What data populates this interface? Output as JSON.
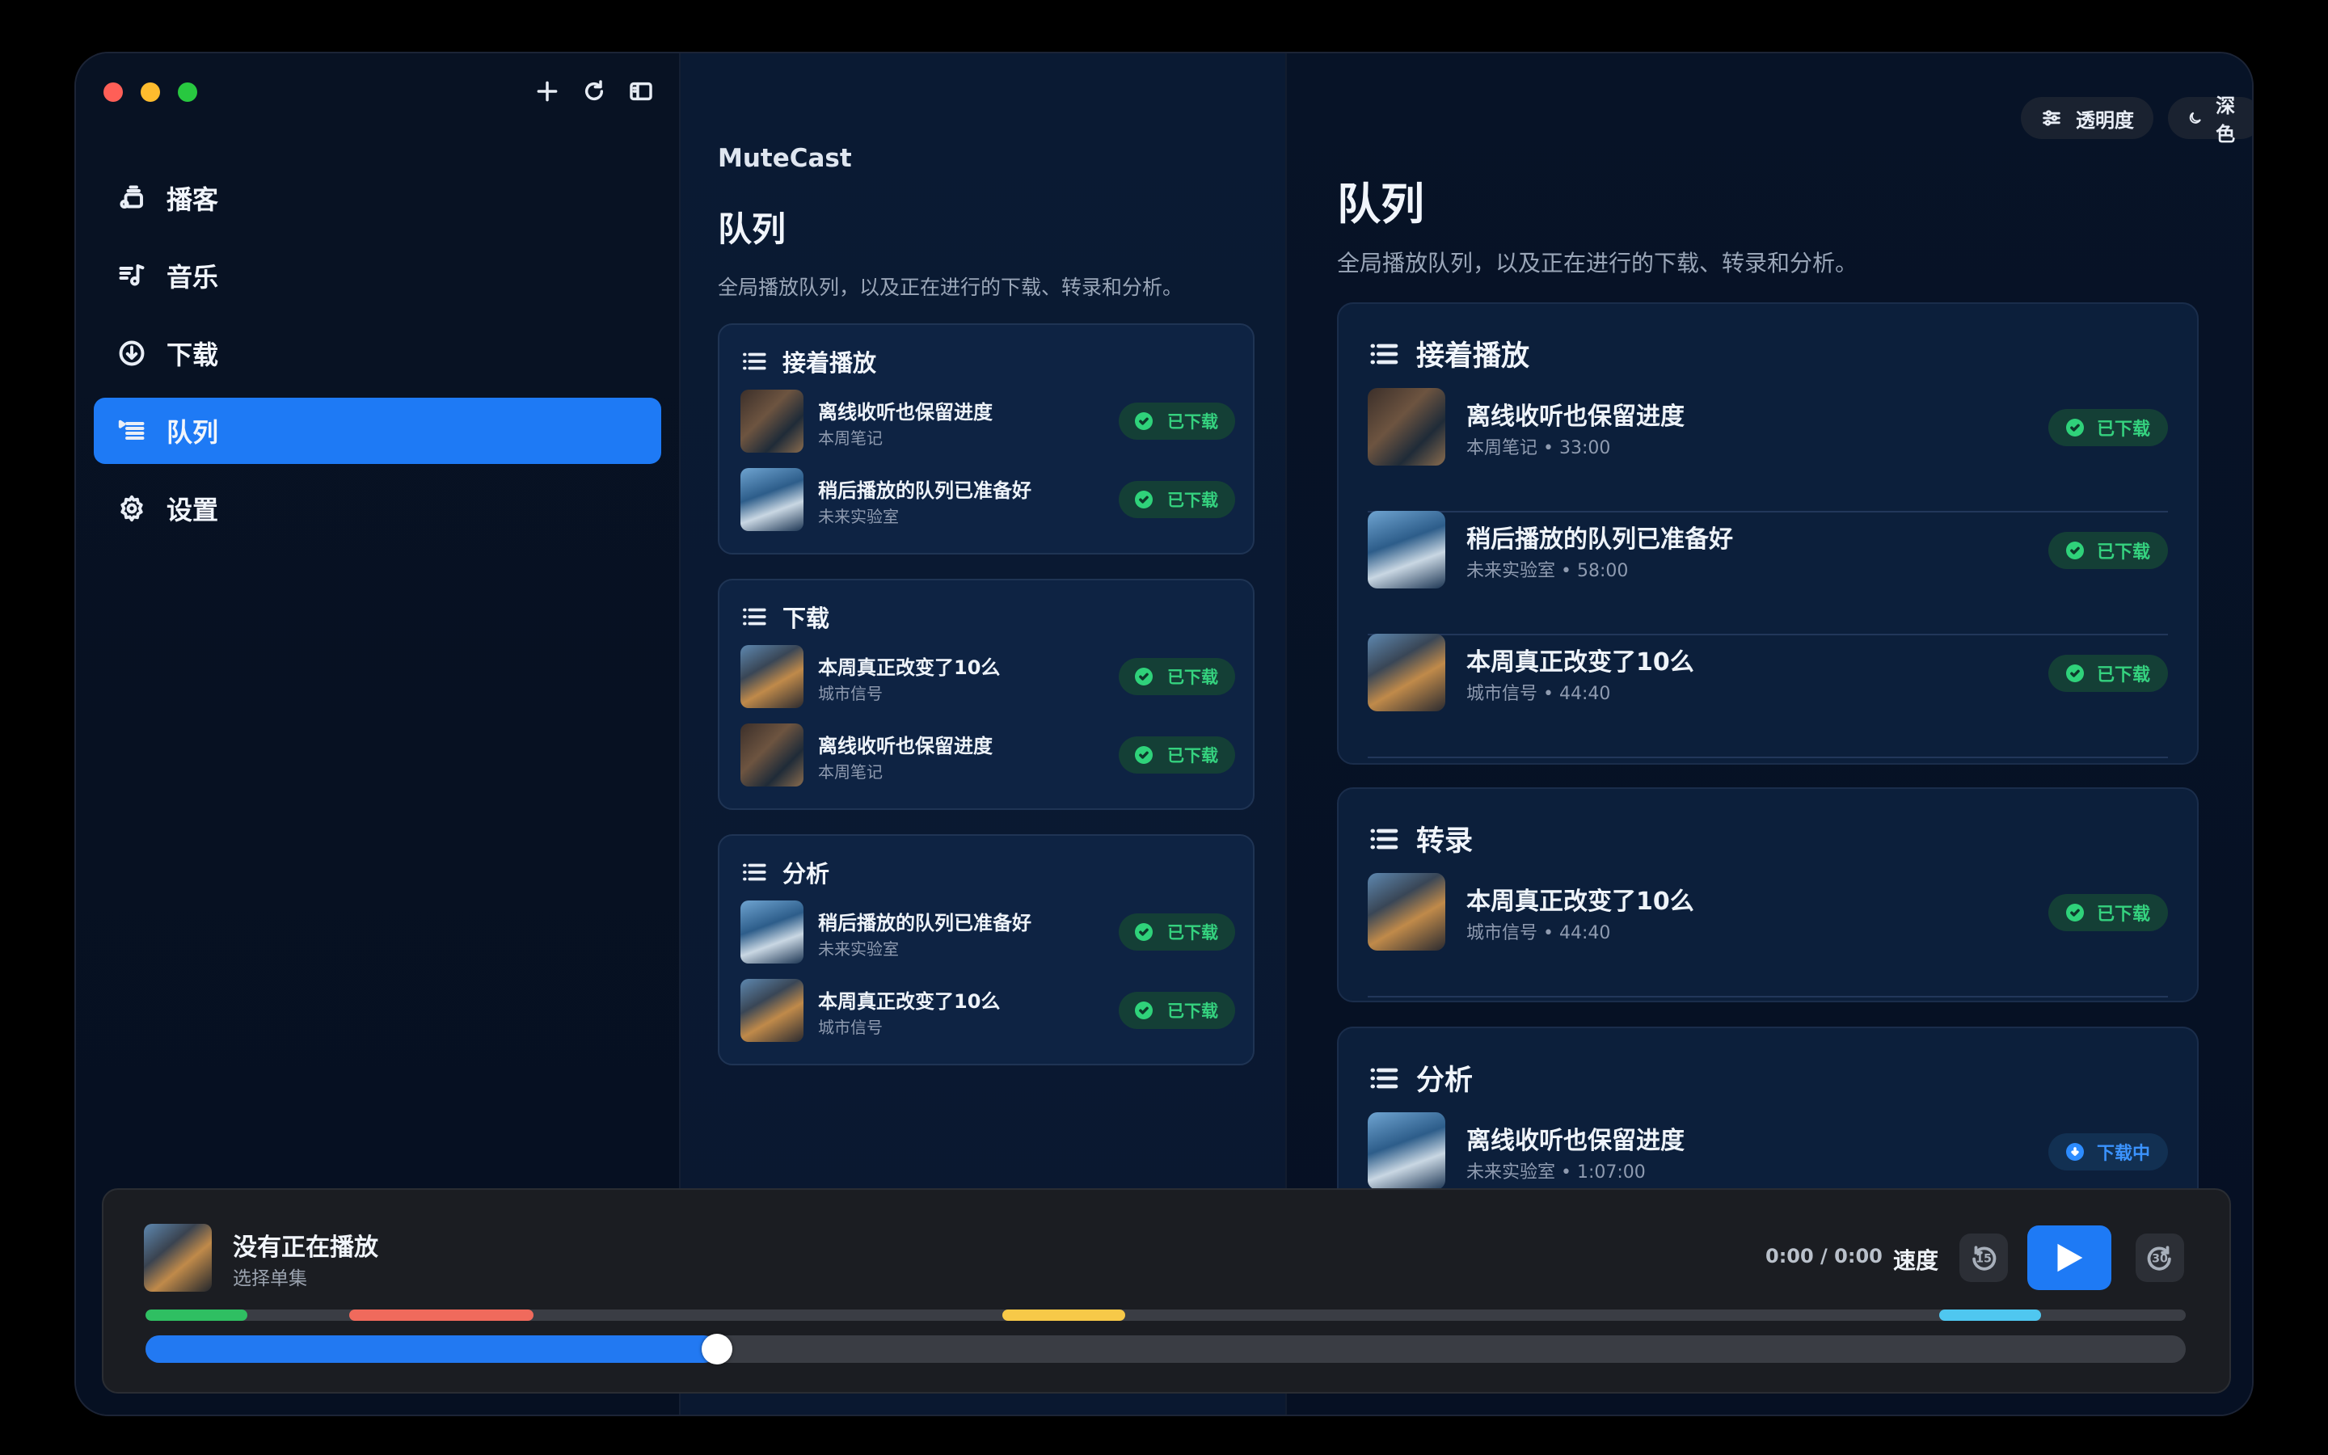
{
  "sidebar": {
    "items": [
      {
        "label": "播客",
        "icon": "podcast-icon"
      },
      {
        "label": "音乐",
        "icon": "music-icon"
      },
      {
        "label": "下载",
        "icon": "download-icon"
      },
      {
        "label": "队列",
        "icon": "queue-icon",
        "active": true
      },
      {
        "label": "设置",
        "icon": "gear-icon"
      }
    ]
  },
  "middle": {
    "app_name": "MuteCast",
    "title": "队列",
    "subtitle": "全局播放队列，以及正在进行的下载、转录和分析。",
    "sections": [
      {
        "title": "接着播放",
        "rows": [
          {
            "title": "离线收听也保留进度",
            "show": "本周笔记",
            "status": "已下载"
          },
          {
            "title": "稍后播放的队列已准备好",
            "show": "未来实验室",
            "status": "已下载"
          }
        ]
      },
      {
        "title": "下载",
        "rows": [
          {
            "title": "本周真正改变了10么",
            "show": "城市信号",
            "status": "已下载"
          },
          {
            "title": "离线收听也保留进度",
            "show": "本周笔记",
            "status": "已下载"
          }
        ]
      },
      {
        "title": "分析",
        "rows": [
          {
            "title": "稍后播放的队列已准备好",
            "show": "未来实验室",
            "status": "已下载"
          },
          {
            "title": "本周真正改变了10么",
            "show": "城市信号",
            "status": "已下载"
          }
        ]
      }
    ]
  },
  "right": {
    "opacity_label": "透明度",
    "theme_label": "深色",
    "title": "队列",
    "subtitle": "全局播放队列，以及正在进行的下载、转录和分析。",
    "sections": [
      {
        "title": "接着播放",
        "rows": [
          {
            "title": "离线收听也保留进度",
            "meta": "本周笔记 • 33:00",
            "status": "已下载"
          },
          {
            "title": "稍后播放的队列已准备好",
            "meta": "未来实验室 • 58:00",
            "status": "已下载"
          },
          {
            "title": "本周真正改变了10么",
            "meta": "城市信号 • 44:40",
            "status": "已下载"
          }
        ]
      },
      {
        "title": "转录",
        "rows": [
          {
            "title": "本周真正改变了10么",
            "meta": "城市信号 • 44:40",
            "status": "已下载"
          }
        ]
      },
      {
        "title": "分析",
        "rows": [
          {
            "title": "离线收听也保留进度",
            "meta": "未来实验室 • 1:07:00",
            "status": "下载中"
          }
        ]
      }
    ]
  },
  "player": {
    "title": "没有正在播放",
    "subtitle": "选择单集",
    "time": "0:00 / 0:00",
    "speed_label": "速度",
    "rewind_seconds": "15",
    "forward_seconds": "30",
    "progress_fraction": 0.28,
    "segments": [
      {
        "start": 0.0,
        "end": 0.05,
        "color": "#2fbf62"
      },
      {
        "start": 0.1,
        "end": 0.19,
        "color": "#f06a5c"
      },
      {
        "start": 0.42,
        "end": 0.48,
        "color": "#f7c948"
      },
      {
        "start": 0.879,
        "end": 0.929,
        "color": "#4fc7f0"
      }
    ]
  },
  "colors": {
    "accent": "#1e7af5",
    "success": "#35d27f",
    "progress": "#3b93ff"
  }
}
